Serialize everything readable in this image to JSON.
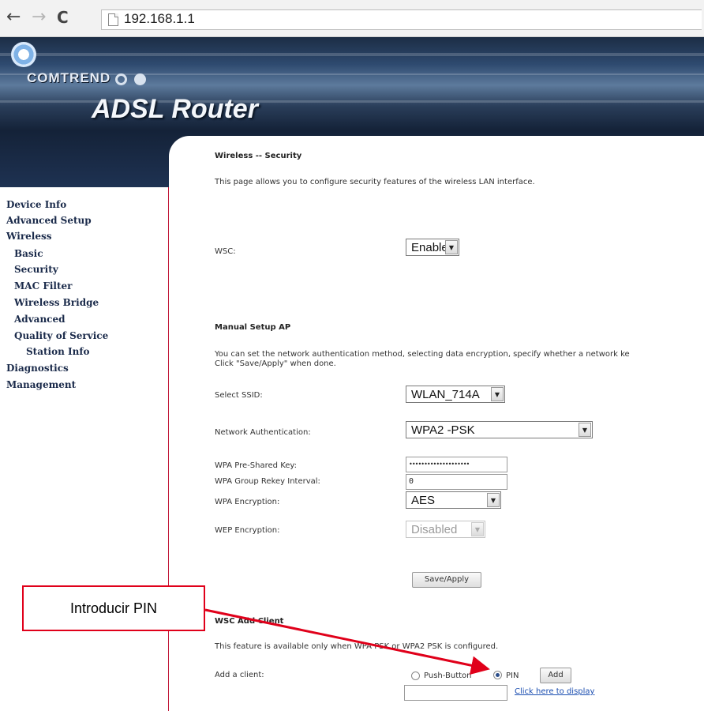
{
  "browser": {
    "url": "192.168.1.1",
    "back_icon": "arrow-left-icon",
    "forward_icon": "arrow-right-icon",
    "reload_icon": "reload-icon",
    "page_icon": "page-icon"
  },
  "header": {
    "brand": "COMTREND",
    "product": "ADSL Router",
    "colors": {
      "banner_dark": "#142238",
      "accent_border": "#c21a3a"
    }
  },
  "nav": {
    "items": [
      {
        "label": "Device Info",
        "level": 1
      },
      {
        "label": "Advanced Setup",
        "level": 1
      },
      {
        "label": "Wireless",
        "level": 1
      },
      {
        "label": "Basic",
        "level": 2
      },
      {
        "label": "Security",
        "level": 2
      },
      {
        "label": "MAC Filter",
        "level": 2
      },
      {
        "label": "Wireless Bridge",
        "level": 2
      },
      {
        "label": "Advanced",
        "level": 2
      },
      {
        "label": "Quality of Service",
        "level": 2
      },
      {
        "label": "Station Info",
        "level": 2
      },
      {
        "label": "Diagnostics",
        "level": 1
      },
      {
        "label": "Management",
        "level": 1
      }
    ]
  },
  "content": {
    "title": "Wireless -- Security",
    "description": "This page allows you to configure security features of the wireless LAN interface.",
    "wsc": {
      "label": "WSC:",
      "value": "Enable"
    },
    "manual_setup": {
      "heading": "Manual Setup AP",
      "desc_line1": "You can set the network authentication method, selecting data encryption, specify whether a network ke",
      "desc_line2": "Click \"Save/Apply\" when done.",
      "select_ssid": {
        "label": "Select SSID:",
        "value": "WLAN_714A"
      },
      "network_auth": {
        "label": "Network Authentication:",
        "value": "WPA2 -PSK"
      },
      "psk": {
        "label": "WPA Pre-Shared Key:",
        "value": "••••••••••••••••••••"
      },
      "rekey": {
        "label": "WPA Group Rekey Interval:",
        "value": "0"
      },
      "wpa_encryption": {
        "label": "WPA Encryption:",
        "value": "AES"
      },
      "wep_encryption": {
        "label": "WEP Encryption:",
        "value": "Disabled"
      },
      "save_button": "Save/Apply"
    },
    "wsc_add_client": {
      "heading": "WSC Add Client",
      "desc": "This feature is available only when WPA PSK or WPA2 PSK is configured.",
      "add_client_label": "Add a client:",
      "option_push": "Push-Button",
      "option_pin": "PIN",
      "selected": "PIN",
      "add_button": "Add",
      "pin_value": "",
      "display_link": "Click here to display"
    }
  },
  "annotation": {
    "callout_text": "Introducir PIN",
    "color": "#e0001a"
  }
}
